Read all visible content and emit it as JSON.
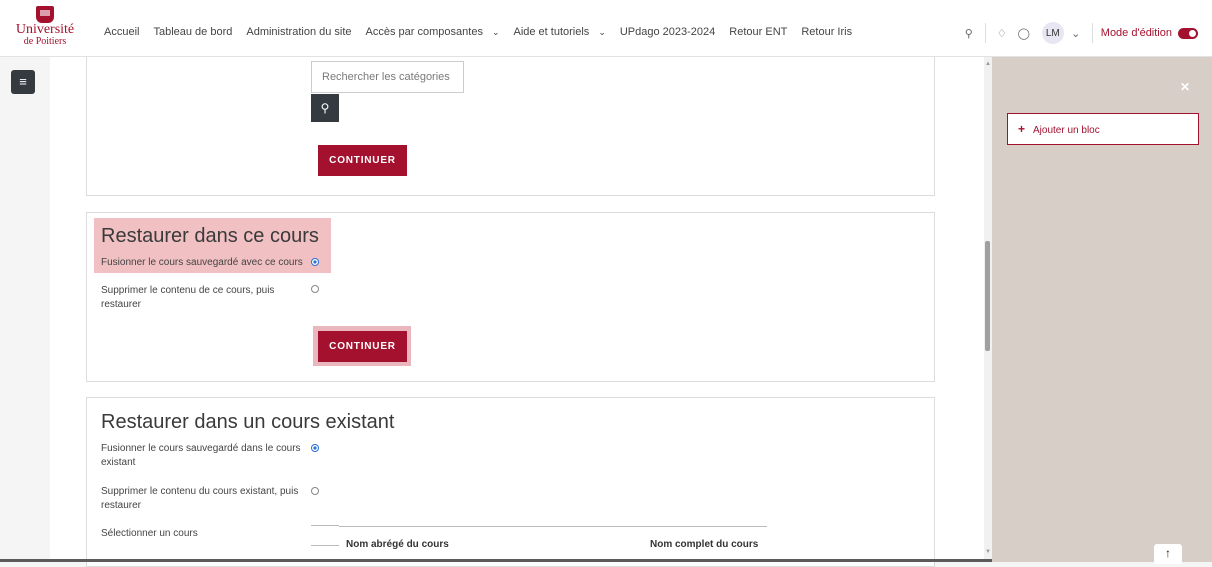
{
  "logo": {
    "word1": "Université",
    "word2": "de Poitiers"
  },
  "nav": {
    "items": [
      {
        "label": "Accueil",
        "has_chevron": false
      },
      {
        "label": "Tableau de bord",
        "has_chevron": false
      },
      {
        "label": "Administration du site",
        "has_chevron": false
      },
      {
        "label": "Accès par composantes",
        "has_chevron": true
      },
      {
        "label": "Aide et tutoriels",
        "has_chevron": true
      },
      {
        "label": "UPdago 2023-2024",
        "has_chevron": false
      },
      {
        "label": "Retour ENT",
        "has_chevron": false
      },
      {
        "label": "Retour Iris",
        "has_chevron": false
      }
    ],
    "user_initials": "LM",
    "edit_mode_label": "Mode d'édition",
    "edit_mode_on": true
  },
  "search": {
    "placeholder": "Rechercher les catégories"
  },
  "buttons": {
    "continue_label": "CONTINUER"
  },
  "section_restore_this": {
    "title": "Restaurer dans ce cours",
    "options": [
      {
        "label": "Fusionner le cours sauvegardé avec ce cours",
        "selected": true
      },
      {
        "label": "Supprimer le contenu de ce cours, puis restaurer",
        "selected": false
      }
    ]
  },
  "section_restore_existing": {
    "title": "Restaurer dans un cours existant",
    "options": [
      {
        "label": "Fusionner le cours sauvegardé dans le cours existant",
        "selected": true
      },
      {
        "label": "Supprimer le contenu du cours existant, puis restaurer",
        "selected": false
      }
    ],
    "select_label": "Sélectionner un cours",
    "table_headers": [
      "Nom abrégé du cours",
      "Nom complet du cours"
    ]
  },
  "drawer": {
    "add_block_label": "Ajouter un bloc"
  },
  "colors": {
    "accent": "#a3112e",
    "drawer_bg": "#d7cfc7",
    "highlight": "#f0c0c3"
  }
}
